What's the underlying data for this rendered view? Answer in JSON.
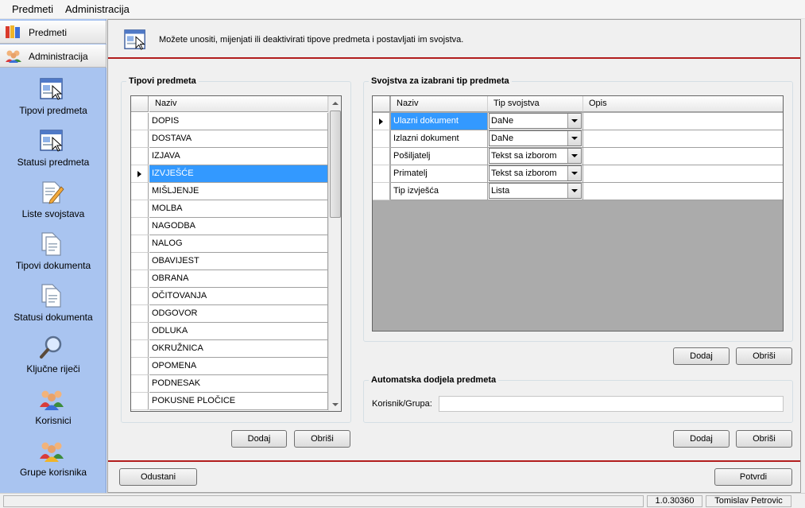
{
  "menu": [
    "Predmeti",
    "Administracija"
  ],
  "nav": {
    "headers": [
      "Predmeti",
      "Administracija"
    ],
    "items": [
      {
        "label": "Tipovi predmeta",
        "icon": "window-cursor-icon"
      },
      {
        "label": "Statusi predmeta",
        "icon": "window-cursor-icon"
      },
      {
        "label": "Liste svojstava",
        "icon": "document-pencil-icon"
      },
      {
        "label": "Tipovi dokumenta",
        "icon": "documents-icon"
      },
      {
        "label": "Statusi dokumenta",
        "icon": "documents-icon"
      },
      {
        "label": "Ključne riječi",
        "icon": "magnifier-icon"
      },
      {
        "label": "Korisnici",
        "icon": "users-icon"
      },
      {
        "label": "Grupe korisnika",
        "icon": "users-group-icon"
      }
    ]
  },
  "info": {
    "text": "Možete unositi, mijenjati ili deaktivirati tipove predmeta i postavljati im svojstva."
  },
  "tipovi": {
    "title": "Tipovi predmeta",
    "column": "Naziv",
    "selected_index": 3,
    "rows": [
      "DOPIS",
      "DOSTAVA",
      "IZJAVA",
      "IZVJEŠĆE",
      "MIŠLJENJE",
      "MOLBA",
      "NAGODBA",
      "NALOG",
      "OBAVIJEST",
      "OBRANA",
      "OČITOVANJA",
      "ODGOVOR",
      "ODLUKA",
      "OKRUŽNICA",
      "OPOMENA",
      "PODNESAK",
      "POKUSNE PLOČICE"
    ],
    "add_label": "Dodaj",
    "remove_label": "Obriši"
  },
  "svojstva": {
    "title": "Svojstva za izabrani tip predmeta",
    "columns": [
      "Naziv",
      "Tip svojstva",
      "Opis"
    ],
    "rows": [
      {
        "naziv": "Ulazni dokument",
        "tip": "DaNe",
        "opis": ""
      },
      {
        "naziv": "Izlazni dokument",
        "tip": "DaNe",
        "opis": ""
      },
      {
        "naziv": "Pošiljatelj",
        "tip": "Tekst sa izborom",
        "opis": ""
      },
      {
        "naziv": "Primatelj",
        "tip": "Tekst sa izborom",
        "opis": ""
      },
      {
        "naziv": "Tip izvješća",
        "tip": "Lista",
        "opis": ""
      }
    ],
    "add_label": "Dodaj",
    "remove_label": "Obriši"
  },
  "dodjela": {
    "title": "Automatska dodjela predmeta",
    "field_label": "Korisnik/Grupa:",
    "field_value": "",
    "add_label": "Dodaj",
    "remove_label": "Obriši"
  },
  "footer": {
    "cancel_label": "Odustani",
    "confirm_label": "Potvrdi"
  },
  "status": {
    "message": "",
    "version": "1.0.30360",
    "user": "Tomislav Petrovic"
  }
}
